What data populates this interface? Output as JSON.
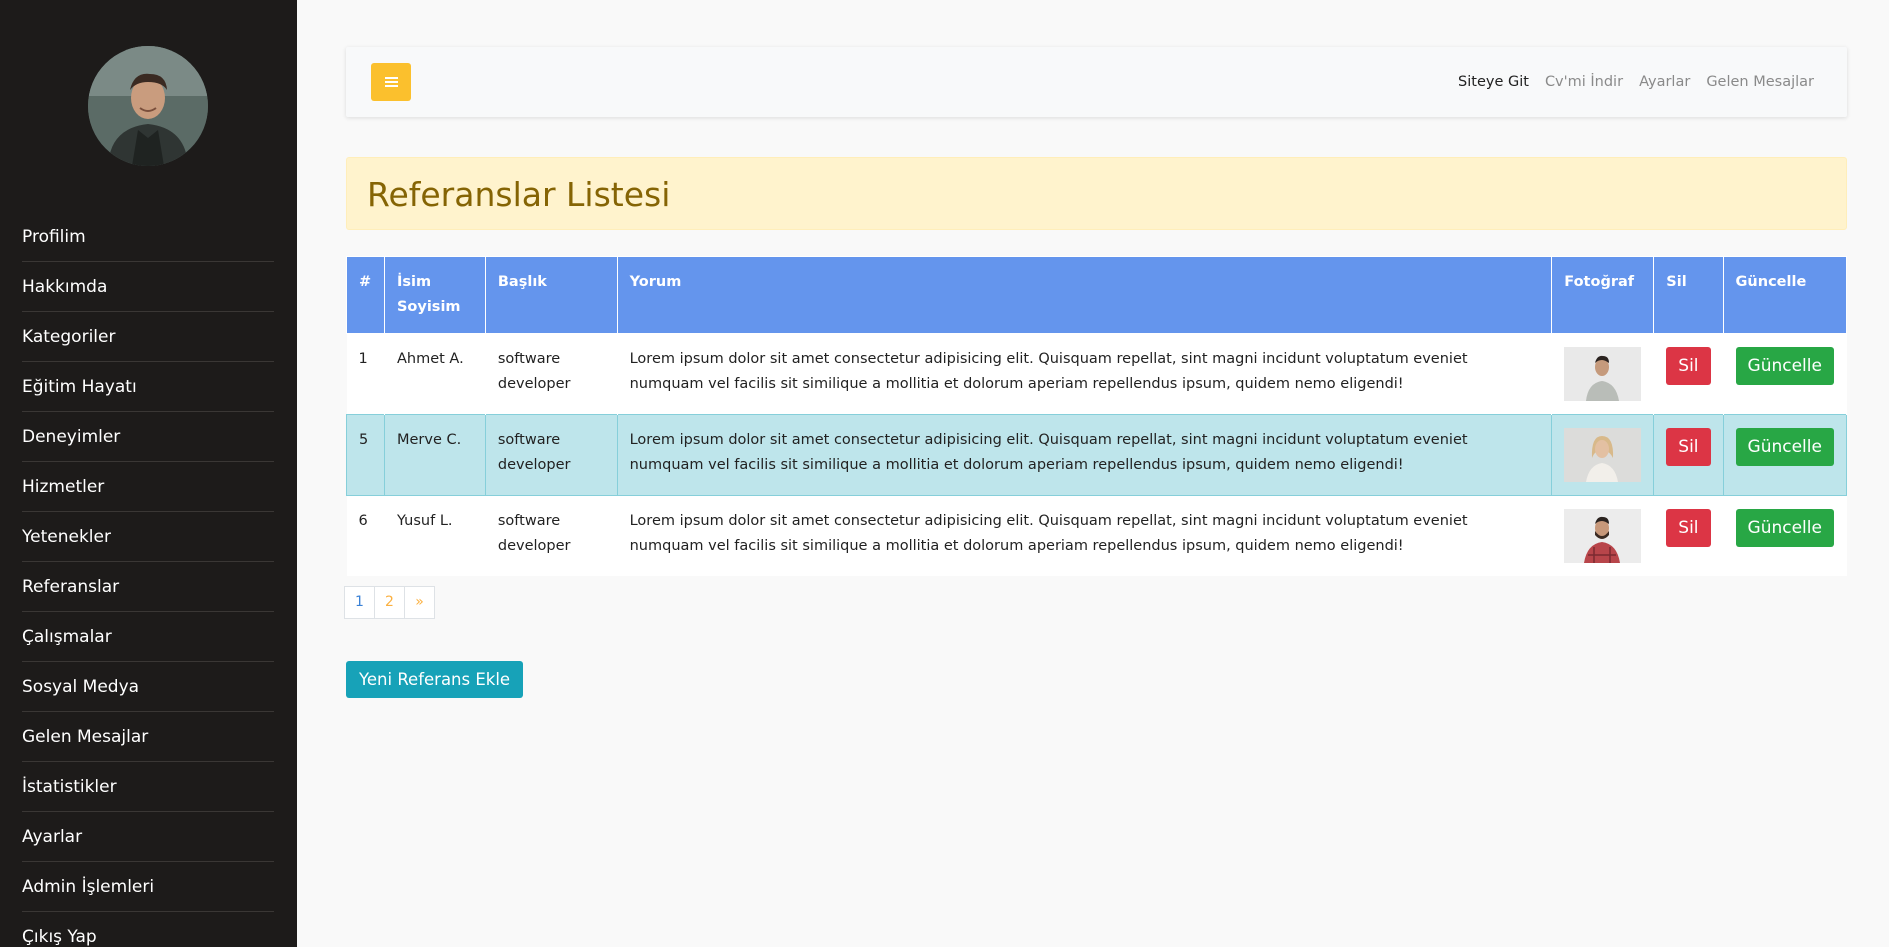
{
  "sidebar": {
    "items": [
      {
        "label": "Profilim"
      },
      {
        "label": "Hakkımda"
      },
      {
        "label": "Kategoriler"
      },
      {
        "label": "Eğitim Hayatı"
      },
      {
        "label": "Deneyimler"
      },
      {
        "label": "Hizmetler"
      },
      {
        "label": "Yetenekler"
      },
      {
        "label": "Referanslar"
      },
      {
        "label": "Çalışmalar"
      },
      {
        "label": "Sosyal Medya"
      },
      {
        "label": "Gelen Mesajlar"
      },
      {
        "label": "İstatistikler"
      },
      {
        "label": "Ayarlar"
      },
      {
        "label": "Admin İşlemleri"
      },
      {
        "label": "Çıkış Yap"
      }
    ]
  },
  "topbar": {
    "toggle_icon": "bars-icon",
    "links": [
      {
        "label": "Siteye Git"
      },
      {
        "label": "Cv'mi İndir"
      },
      {
        "label": "Ayarlar"
      },
      {
        "label": "Gelen Mesajlar"
      }
    ]
  },
  "page": {
    "title": "Referanslar Listesi"
  },
  "table": {
    "headers": {
      "num": "#",
      "name": "İsim Soyisim",
      "title": "Başlık",
      "comment": "Yorum",
      "photo": "Fotoğraf",
      "delete": "Sil",
      "update": "Güncelle"
    },
    "rows": [
      {
        "num": "1",
        "name": "Ahmet A.",
        "title": "software developer",
        "comment": "Lorem ipsum dolor sit amet consectetur adipisicing elit. Quisquam repellat, sint magni incidunt voluptatum eveniet numquam vel facilis sit similique a mollitia et dolorum aperiam repellendus ipsum, quidem nemo eligendi!",
        "delete_label": "Sil",
        "update_label": "Güncelle"
      },
      {
        "num": "5",
        "name": "Merve C.",
        "title": "software developer",
        "comment": "Lorem ipsum dolor sit amet consectetur adipisicing elit. Quisquam repellat, sint magni incidunt voluptatum eveniet numquam vel facilis sit similique a mollitia et dolorum aperiam repellendus ipsum, quidem nemo eligendi!",
        "delete_label": "Sil",
        "update_label": "Güncelle"
      },
      {
        "num": "6",
        "name": "Yusuf L.",
        "title": "software developer",
        "comment": "Lorem ipsum dolor sit amet consectetur adipisicing elit. Quisquam repellat, sint magni incidunt voluptatum eveniet numquam vel facilis sit similique a mollitia et dolorum aperiam repellendus ipsum, quidem nemo eligendi!",
        "delete_label": "Sil",
        "update_label": "Güncelle"
      }
    ]
  },
  "pagination": {
    "pages": [
      "1",
      "2"
    ],
    "next": "»"
  },
  "actions": {
    "add_label": "Yeni Referans Ekle"
  },
  "colors": {
    "sidebar_bg": "#1d1b1a",
    "header_bg": "#6495ed",
    "toggle_bg": "#fbc02d",
    "alert_bg": "#fff3cd",
    "alert_text": "#856404",
    "row_info_bg": "#bee5eb",
    "danger": "#dc3545",
    "success": "#28a745",
    "info": "#17a2b8"
  }
}
